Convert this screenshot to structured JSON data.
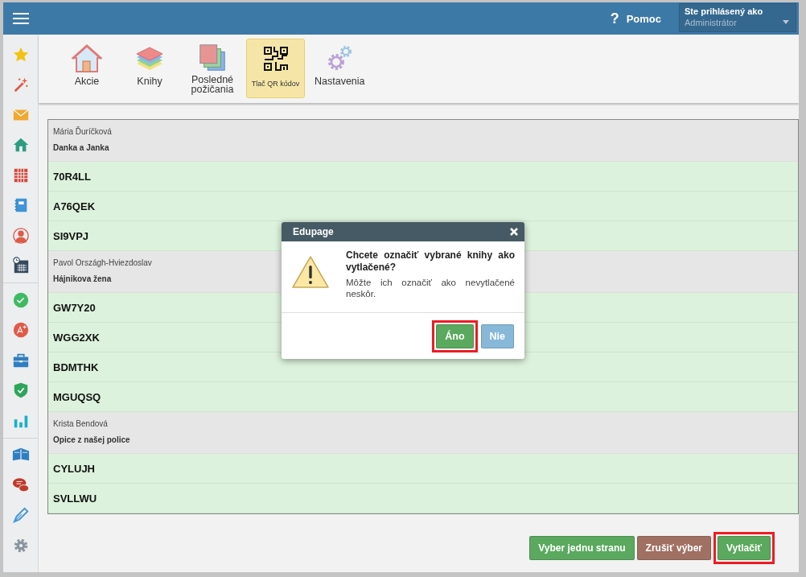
{
  "header": {
    "help_icon": "?",
    "help": "Pomoc",
    "user_label": "Ste prihlásený ako",
    "user_name": "Administrátor"
  },
  "toolbar": [
    {
      "label": "Akcie",
      "selected": false
    },
    {
      "label": "Knihy",
      "selected": false
    },
    {
      "label": "Posledné požičania",
      "selected": false
    },
    {
      "label": "Tlač QR kódov",
      "selected": true
    },
    {
      "label": "Nastavenia",
      "selected": false
    }
  ],
  "groups": [
    {
      "author": "Mária Ďuríčková",
      "title": "Danka a Janka",
      "codes": [
        "70R4LL",
        "A76QEK",
        "SI9VPJ"
      ]
    },
    {
      "author": "Pavol Országh-Hviezdoslav",
      "title": "Hájnikova žena",
      "codes": [
        "GW7Y20",
        "WGG2XK",
        "BDMTHK",
        "MGUQSQ"
      ]
    },
    {
      "author": "Krista Bendová",
      "title": "Opice z našej police",
      "codes": [
        "CYLUJH",
        "SVLLWU"
      ]
    }
  ],
  "dialog": {
    "title": "Edupage",
    "question": "Chcete označiť vybrané knihy ako vytlačené?",
    "note": "Môžte ich označiť ako nevytlačené neskôr.",
    "buttons": [
      {
        "label": "Áno",
        "kind": "confirm",
        "highlighted": true
      },
      {
        "label": "Nie",
        "kind": "decline",
        "highlighted": false
      }
    ]
  },
  "actions": [
    {
      "label": "Vyber jednu stranu",
      "kind": "confirm",
      "highlighted": false
    },
    {
      "label": "Zrušiť výber",
      "kind": "cancel",
      "highlighted": false
    },
    {
      "label": "Vytlačiť",
      "kind": "confirm",
      "highlighted": true
    }
  ]
}
